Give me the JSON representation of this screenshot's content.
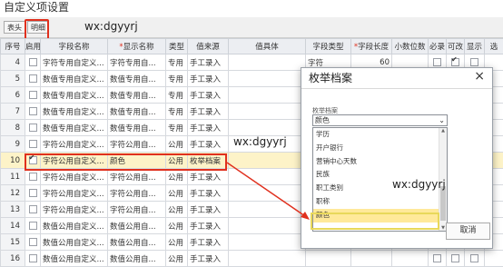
{
  "window_title": "自定义项设置",
  "tabs": [
    {
      "label": "表头"
    },
    {
      "label": "明细"
    }
  ],
  "watermark": "wx:dgyyrj",
  "columns": [
    {
      "label": "序号",
      "required": false
    },
    {
      "label": "启用",
      "required": false
    },
    {
      "label": "字段名称",
      "required": false
    },
    {
      "label": "显示名称",
      "required": true
    },
    {
      "label": "类型",
      "required": false
    },
    {
      "label": "值来源",
      "required": false
    },
    {
      "label": "值具体",
      "required": false
    },
    {
      "label": "字段类型",
      "required": false
    },
    {
      "label": "字段长度",
      "required": true
    },
    {
      "label": "小数位数",
      "required": false
    },
    {
      "label": "必录",
      "required": false
    },
    {
      "label": "可改",
      "required": false
    },
    {
      "label": "显示",
      "required": false
    },
    {
      "label": "选",
      "required": false
    }
  ],
  "rows": [
    {
      "no": "4",
      "enabled": false,
      "field": "字符专用自定义...",
      "display": "字符专用自...",
      "type": "专用",
      "source": "手工录入",
      "detail": "",
      "ftype": "字符",
      "length": "60",
      "decimals": "",
      "required": false,
      "editable": true,
      "show": false
    },
    {
      "no": "5",
      "enabled": false,
      "field": "数值专用自定义...",
      "display": "数值专用自...",
      "type": "专用",
      "source": "手工录入",
      "detail": "",
      "ftype": "",
      "length": "",
      "decimals": "",
      "required": false,
      "editable": false,
      "show": false
    },
    {
      "no": "6",
      "enabled": false,
      "field": "数值专用自定义...",
      "display": "数值专用自...",
      "type": "专用",
      "source": "手工录入",
      "detail": "",
      "ftype": "",
      "length": "",
      "decimals": "",
      "required": false,
      "editable": false,
      "show": false
    },
    {
      "no": "7",
      "enabled": false,
      "field": "数值专用自定义...",
      "display": "数值专用自...",
      "type": "专用",
      "source": "手工录入",
      "detail": "",
      "ftype": "",
      "length": "",
      "decimals": "",
      "required": false,
      "editable": false,
      "show": false
    },
    {
      "no": "8",
      "enabled": false,
      "field": "数值专用自定义...",
      "display": "数值专用自...",
      "type": "专用",
      "source": "手工录入",
      "detail": "",
      "ftype": "",
      "length": "",
      "decimals": "",
      "required": false,
      "editable": false,
      "show": false
    },
    {
      "no": "9",
      "enabled": false,
      "field": "字符公用自定义...",
      "display": "字符公用自...",
      "type": "公用",
      "source": "手工录入",
      "detail": "",
      "ftype": "",
      "length": "",
      "decimals": "",
      "required": false,
      "editable": false,
      "show": false
    },
    {
      "no": "10",
      "enabled": true,
      "field": "字符公用自定义...",
      "display": "颜色",
      "type": "公用",
      "source": "枚举档案",
      "detail": "",
      "ftype": "",
      "length": "",
      "decimals": "",
      "required": false,
      "editable": false,
      "show": false
    },
    {
      "no": "11",
      "enabled": false,
      "field": "字符公用自定义...",
      "display": "字符公用自...",
      "type": "公用",
      "source": "手工录入",
      "detail": "",
      "ftype": "",
      "length": "",
      "decimals": "",
      "required": false,
      "editable": false,
      "show": false
    },
    {
      "no": "12",
      "enabled": false,
      "field": "字符公用自定义...",
      "display": "字符公用自...",
      "type": "公用",
      "source": "手工录入",
      "detail": "",
      "ftype": "",
      "length": "",
      "decimals": "",
      "required": false,
      "editable": false,
      "show": false
    },
    {
      "no": "13",
      "enabled": false,
      "field": "字符公用自定义...",
      "display": "字符公用自...",
      "type": "公用",
      "source": "手工录入",
      "detail": "",
      "ftype": "",
      "length": "",
      "decimals": "",
      "required": false,
      "editable": false,
      "show": false
    },
    {
      "no": "14",
      "enabled": false,
      "field": "数值公用自定义...",
      "display": "数值公用自...",
      "type": "公用",
      "source": "手工录入",
      "detail": "",
      "ftype": "",
      "length": "",
      "decimals": "",
      "required": false,
      "editable": false,
      "show": false
    },
    {
      "no": "15",
      "enabled": false,
      "field": "数值公用自定义...",
      "display": "数值公用自...",
      "type": "公用",
      "source": "手工录入",
      "detail": "",
      "ftype": "",
      "length": "",
      "decimals": "",
      "required": false,
      "editable": false,
      "show": false
    },
    {
      "no": "16",
      "enabled": false,
      "field": "数值公用自定义...",
      "display": "数值公用自...",
      "type": "公用",
      "source": "手工录入",
      "detail": "",
      "ftype": "",
      "length": "",
      "decimals": "",
      "required": false,
      "editable": false,
      "show": false
    }
  ],
  "selected_row_no": "10",
  "dialog": {
    "title": "枚举档案",
    "close": "×",
    "field_label": "枚举档案",
    "selected_value": "颜色",
    "options": [
      "学历",
      "开户银行",
      "营销中心天数",
      "民族",
      "职工类别",
      "职称",
      "颜色"
    ],
    "selected_option": "颜色",
    "cancel_label": "取消"
  },
  "colors": {
    "highlight_red": "#e0301e",
    "selected_row": "#fdf3c8",
    "selected_option": "#ffe99a"
  }
}
